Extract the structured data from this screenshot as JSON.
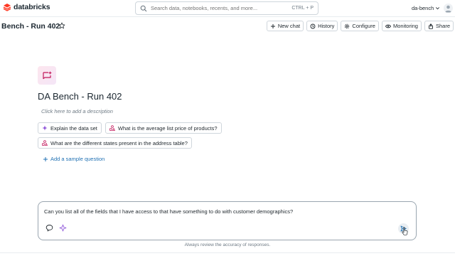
{
  "app": {
    "logo_text": "databricks",
    "search_placeholder": "Search data, notebooks, recents, and more...",
    "search_shortcut": "CTRL + P",
    "workspace_name": "da-bench"
  },
  "header": {
    "title": "Bench - Run 402",
    "actions": [
      {
        "label": "New chat",
        "icon": "plus-icon"
      },
      {
        "label": "History",
        "icon": "history-icon"
      },
      {
        "label": "Configure",
        "icon": "gear-icon"
      },
      {
        "label": "Monitoring",
        "icon": "eye-icon"
      },
      {
        "label": "Share",
        "icon": "share-icon"
      }
    ]
  },
  "space": {
    "title": "DA Bench - Run 402",
    "description_placeholder": "Click here to add a description",
    "sample_questions": [
      {
        "label": "Explain the data set",
        "icon": "sparkle-icon"
      },
      {
        "label": "What is the average list price of products?",
        "icon": "shapes-icon"
      },
      {
        "label": "What are the different states present in the address table?",
        "icon": "shapes-icon"
      }
    ],
    "add_sample_label": "Add a sample question"
  },
  "composer": {
    "text": "Can you list all of the fields that I have access to that have something to do with customer demographics?",
    "disclaimer": "Always review the accuracy of responses."
  },
  "colors": {
    "accent_blue": "#2272b4",
    "brand_red": "#ff3621",
    "border": "#cfd6dc"
  }
}
